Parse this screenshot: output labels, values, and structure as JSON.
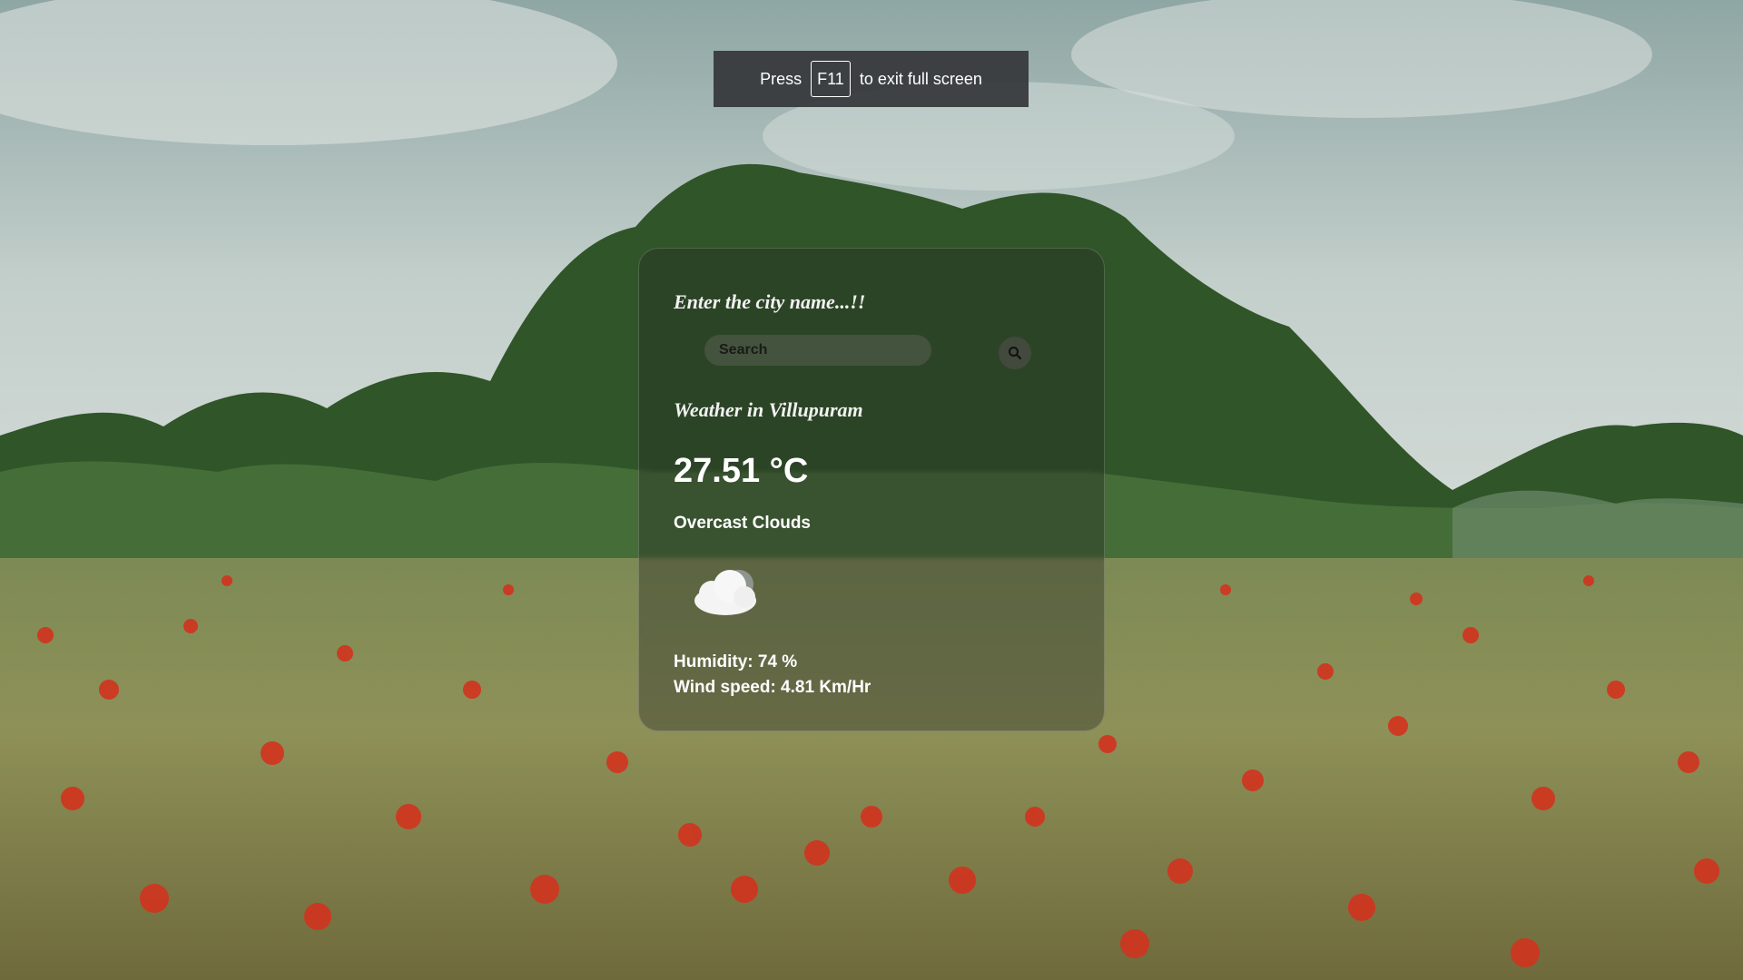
{
  "fullscreen_toast": {
    "press": "Press",
    "key": "F11",
    "suffix": "to exit full screen"
  },
  "weather_card": {
    "prompt": "Enter the city name...!!",
    "search": {
      "placeholder": "Search",
      "value": ""
    },
    "search_button_icon": "magnifier-icon",
    "city_heading": "Weather in Villupuram",
    "temperature": "27.51 °C",
    "description": "Overcast Clouds",
    "condition_icon": "cloud-icon",
    "humidity": "Humidity: 74 %",
    "wind_speed": "Wind speed: 4.81 Km/Hr"
  },
  "background": {
    "subject": "poppy-field-landscape",
    "colors": {
      "sky": "#c9d3d0",
      "trees": "#2f5a2a",
      "field": "#8a8f5a",
      "poppy": "#d9361f"
    }
  }
}
